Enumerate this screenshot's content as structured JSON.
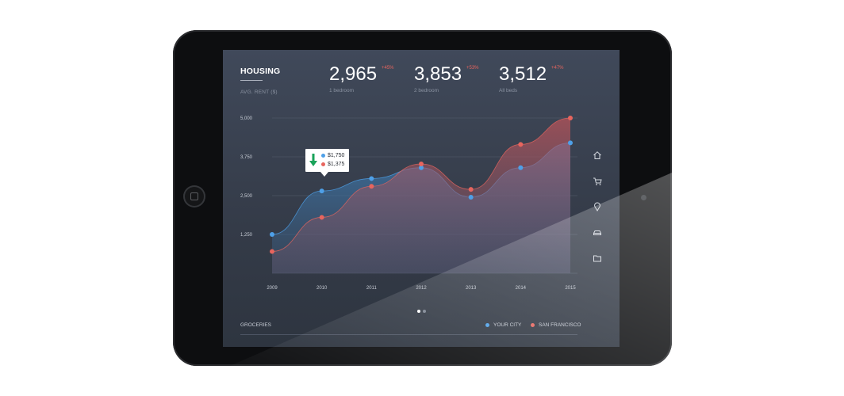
{
  "header": {
    "title": "HOUSING",
    "subtitle": "AVG. RENT ($)"
  },
  "stats": [
    {
      "value": "2,965",
      "change": "+45%",
      "label": "1 bedroom"
    },
    {
      "value": "3,853",
      "change": "+53%",
      "label": "2 bedroom"
    },
    {
      "value": "3,512",
      "change": "+47%",
      "label": "All beds"
    }
  ],
  "chart_data": {
    "type": "area",
    "x": [
      "2009",
      "2010",
      "2011",
      "2012",
      "2013",
      "2014",
      "2015"
    ],
    "yticks": [
      "5,000",
      "3,750",
      "2,500",
      "1,250"
    ],
    "ylim": [
      0,
      5000
    ],
    "series": [
      {
        "name": "YOUR CITY",
        "color": "#4ea0e8",
        "values": [
          1250,
          2650,
          3050,
          3400,
          2450,
          3400,
          4200
        ]
      },
      {
        "name": "SAN FRANCISCO",
        "color": "#e7655e",
        "values": [
          700,
          1800,
          2800,
          3520,
          2700,
          4150,
          5000
        ]
      }
    ],
    "grid": true,
    "legend": "bottom-right"
  },
  "tooltip": {
    "value_1": "$1,750",
    "value_2": "$1,375"
  },
  "side_icons": [
    "home-icon",
    "cart-icon",
    "pin-icon",
    "car-icon",
    "folder-icon"
  ],
  "pager": {
    "pages": 2,
    "active": 1
  },
  "footer": {
    "section": "GROCERIES",
    "legend_1": "YOUR CITY",
    "legend_2": "SAN FRANCISCO"
  },
  "colors": {
    "blue": "#4ea0e8",
    "red": "#e7655e",
    "background": "#3a4250"
  }
}
